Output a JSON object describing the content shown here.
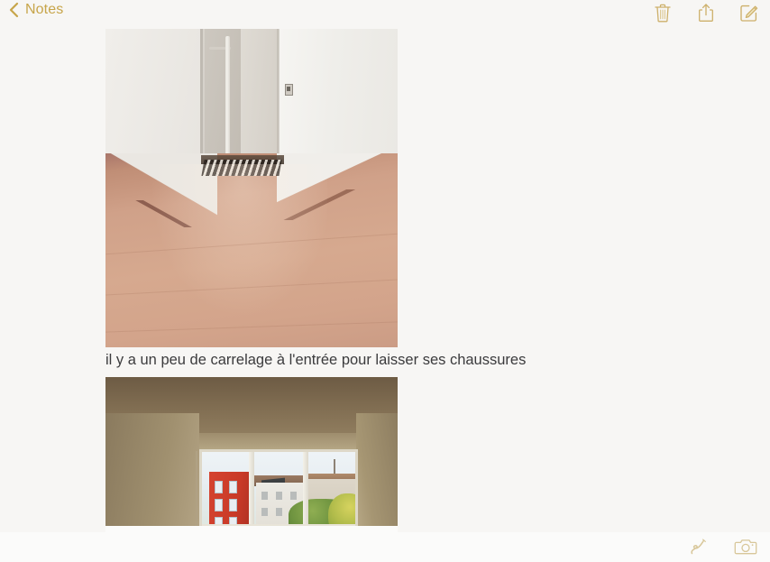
{
  "app": {
    "name": "Notes",
    "accent_color": "#c7a54a",
    "background_color": "#f7f6f4",
    "text_color": "#3b3b3d"
  },
  "topbar": {
    "back_label": "Notes",
    "back_icon": "chevron-left-icon",
    "actions": [
      {
        "name": "delete-note-button",
        "icon": "trash-icon",
        "label": "Delete"
      },
      {
        "name": "share-note-button",
        "icon": "share-icon",
        "label": "Share"
      },
      {
        "name": "compose-note-button",
        "icon": "compose-icon",
        "label": "New Note"
      }
    ]
  },
  "note": {
    "blocks": [
      {
        "type": "image",
        "name": "note-photo-room-empty",
        "alt": "Empty room with white walls, doorway alcove with pipe and wooden laminate floor"
      },
      {
        "type": "text",
        "name": "note-caption",
        "value": "il y a un peu de carrelage à l'entrée pour laisser ses chaussures"
      },
      {
        "type": "image",
        "name": "note-photo-room-window",
        "alt": "Room interior with large window showing a red building, white buildings and green trees outside"
      }
    ]
  },
  "bottombar": {
    "actions": [
      {
        "name": "markup-button",
        "icon": "scribble-icon",
        "label": "Markup"
      },
      {
        "name": "camera-button",
        "icon": "camera-icon",
        "label": "Camera"
      }
    ]
  }
}
